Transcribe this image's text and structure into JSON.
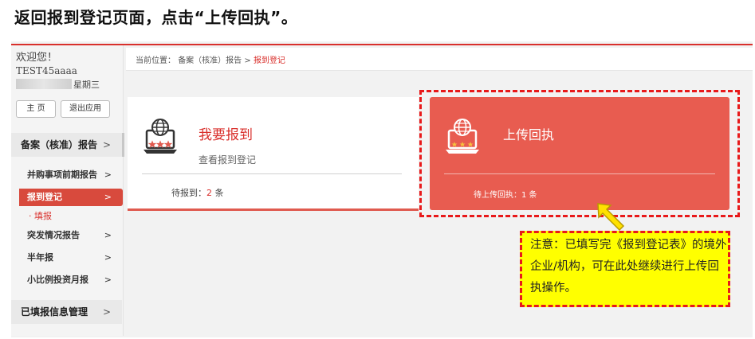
{
  "instruction": "返回报到登记页面，点击“上传回执”。",
  "sidebar": {
    "welcome": "欢迎您！",
    "username": "TEST45aaaa",
    "weekday": "星期三",
    "home_btn": "主 页",
    "exit_btn": "退出应用",
    "main_menu": "备案（核准）报告",
    "main_menu_arrow": ">",
    "items": [
      {
        "label": "并购事项前期报告",
        "arrow": ">"
      },
      {
        "label": "报到登记",
        "arrow": ">"
      },
      {
        "label": "突发情况报告",
        "arrow": ">"
      },
      {
        "label": "半年报",
        "arrow": ">"
      },
      {
        "label": "小比例投资月报",
        "arrow": ">"
      }
    ],
    "sub_item": "· 填报",
    "bottom_menu": "已填报信息管理",
    "bottom_menu_arrow": ">"
  },
  "breadcrumb": {
    "prefix": "当前位置：",
    "path": "备案（核准）报告 >",
    "current": "报到登记"
  },
  "card_report": {
    "title": "我要报到",
    "desc": "查看报到登记",
    "status_label": "待报到：",
    "status_count": "2",
    "status_unit": "条"
  },
  "card_upload": {
    "title": "上传回执",
    "status": "待上传回执：1 条"
  },
  "note": {
    "text": "注意：已填写完《报到登记表》的境外企业/机构，可在此处继续进行上传回执操作。"
  },
  "colors": {
    "accent_red": "#d9302c",
    "card_red": "#e85c50",
    "note_yellow": "#ffff00"
  },
  "icons": [
    "computer-monitor-icon",
    "globe-icon",
    "arrow-pointer-icon"
  ]
}
